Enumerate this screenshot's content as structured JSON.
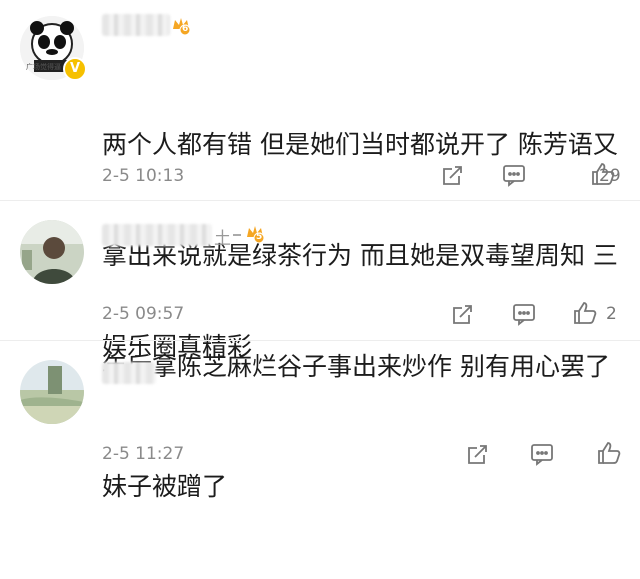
{
  "comments": [
    {
      "avatar_alt": "panda-meme-avatar",
      "badge_level": "6",
      "verified_text": "V",
      "avatar_caption": "广场觉得逼",
      "text_lines": [
        "两个人都有错 但是她们当时都说开了 陈芳语又",
        "拿出来说就是绿茶行为 而且她是双毒望周知 三",
        "年后拿陈芝麻烂谷子事出来炒作 别有用心罢了"
      ],
      "time": "2-5 10:13",
      "likes": "29"
    },
    {
      "avatar_alt": "photo-avatar",
      "name_partial": "土",
      "badge_level": "5",
      "text_lines": [
        "娱乐圈真精彩"
      ],
      "time": "2-5 09:57",
      "likes": "2"
    },
    {
      "avatar_alt": "landscape-avatar",
      "text_lines": [
        "妹子被蹭了"
      ],
      "time": "2-5 11:27",
      "likes": ""
    }
  ],
  "colors": {
    "text": "#1c1c1c",
    "meta": "#8a8a8a",
    "badge": "#f5a623",
    "verified": "#f6c000"
  },
  "icons": [
    "share-icon",
    "comment-icon",
    "like-icon"
  ]
}
